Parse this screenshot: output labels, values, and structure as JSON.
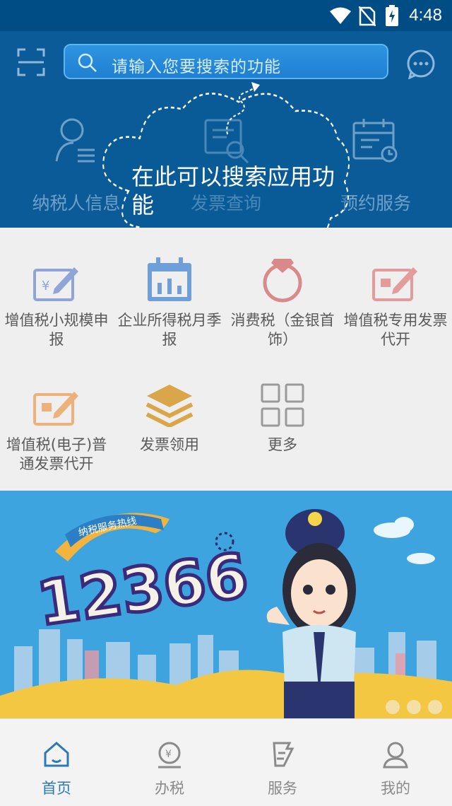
{
  "status_bar": {
    "time": "4:48"
  },
  "search": {
    "placeholder": "请输入您要搜索的功能"
  },
  "top_entries": [
    {
      "label": "纳税人信息",
      "icon": "user-list-icon"
    },
    {
      "label": "发票查询",
      "icon": "invoice-search-icon"
    },
    {
      "label": "预约服务",
      "icon": "calendar-icon"
    }
  ],
  "tooltip": {
    "text": "在此可以搜索应用功能"
  },
  "services": [
    {
      "label": "增值税小规模申报",
      "icon": "tax-edit-icon",
      "color": "#8fa5d8"
    },
    {
      "label": "企业所得税月季报",
      "icon": "calendar-report-icon",
      "color": "#6f9fd8"
    },
    {
      "label": "消费税（金银首饰）",
      "icon": "ring-icon",
      "color": "#d88a8a"
    },
    {
      "label": "增值税专用发票代开",
      "icon": "invoice-edit-icon",
      "color": "#e39b9b"
    },
    {
      "label": "增值税(电子)普通发票代开",
      "icon": "e-invoice-edit-icon",
      "color": "#ecb27a"
    },
    {
      "label": "发票领用",
      "icon": "stack-icon",
      "color": "#d9a64a"
    },
    {
      "label": "更多",
      "icon": "grid-more-icon",
      "color": "#9a9a9a"
    }
  ],
  "banner": {
    "hotline": "12366",
    "slogan": "纳税服务热线"
  },
  "tabs": [
    {
      "label": "首页",
      "icon": "home-icon",
      "active": true
    },
    {
      "label": "办税",
      "icon": "tax-coin-icon",
      "active": false
    },
    {
      "label": "服务",
      "icon": "service-icon",
      "active": false
    },
    {
      "label": "我的",
      "icon": "profile-icon",
      "active": false
    }
  ]
}
